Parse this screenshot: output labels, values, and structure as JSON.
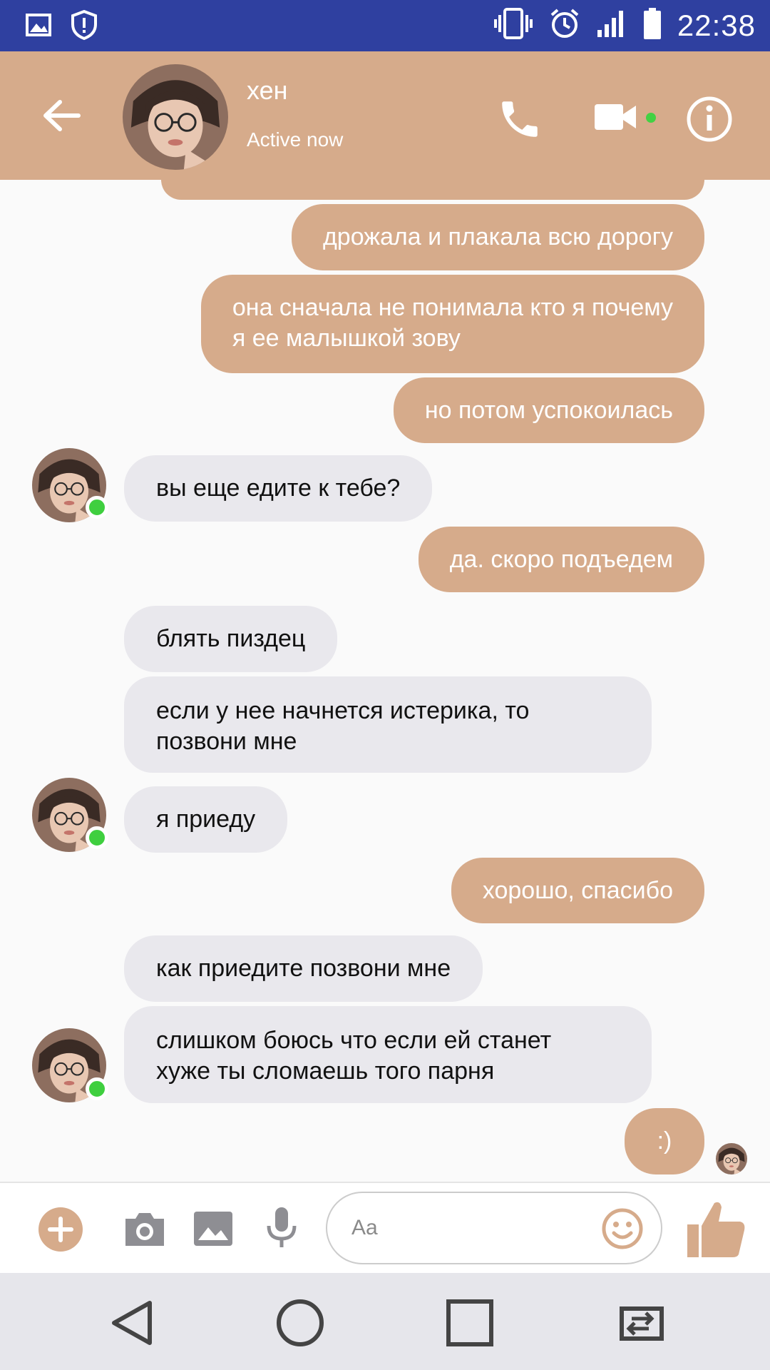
{
  "status_bar": {
    "time": "22:38"
  },
  "header": {
    "contact_name": "хен",
    "contact_status": "Active now"
  },
  "messages": [
    {
      "from": "me",
      "text": ""
    },
    {
      "from": "me",
      "text": "дрожала и плакала всю дорогу"
    },
    {
      "from": "me",
      "lines": [
        "она сначала не понимала кто я почему",
        "я ее малышкой зову"
      ]
    },
    {
      "from": "me",
      "text": "но потом успокоилась"
    },
    {
      "from": "them",
      "text": "вы еще едите к тебе?"
    },
    {
      "from": "me",
      "text": "да. скоро подъедем"
    },
    {
      "from": "them",
      "text": "блять пиздец"
    },
    {
      "from": "them",
      "lines": [
        "если у нее начнется истерика, то",
        "позвони мне"
      ]
    },
    {
      "from": "them",
      "text": "я приеду"
    },
    {
      "from": "me",
      "text": "хорошо, спасибо"
    },
    {
      "from": "them",
      "text": "как приедите позвони мне"
    },
    {
      "from": "them",
      "lines": [
        "слишком боюсь что если ей станет",
        "хуже ты сломаешь того парня"
      ]
    },
    {
      "from": "me",
      "text": ":)"
    }
  ],
  "composer": {
    "placeholder": "Aa"
  },
  "icons": {
    "status_left": [
      "gallery-notification-icon",
      "shield-alert-icon"
    ],
    "status_right": [
      "vibrate-icon",
      "alarm-icon",
      "signal-icon",
      "battery-icon"
    ],
    "header": [
      "back-arrow-icon",
      "phone-icon",
      "video-camera-icon",
      "info-icon"
    ],
    "composer": [
      "plus-icon",
      "camera-icon",
      "gallery-icon",
      "microphone-icon",
      "emoji-icon",
      "thumbs-up-icon"
    ],
    "nav": [
      "nav-back-icon",
      "nav-home-icon",
      "nav-recents-icon",
      "nav-switch-icon"
    ]
  },
  "colors": {
    "status_bar": "#2f40a0",
    "accent": "#d6ab8b",
    "incoming_bubble": "#e9e8ed",
    "online": "#3fcf3f",
    "background": "#fafafa"
  }
}
